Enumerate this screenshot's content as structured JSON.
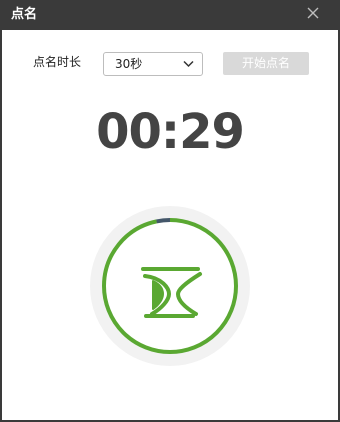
{
  "window": {
    "title": "点名"
  },
  "settings": {
    "duration_label": "点名时长",
    "duration_value": "30秒"
  },
  "actions": {
    "start_label": "开始点名"
  },
  "countdown": {
    "time_text": "00:29",
    "elapsed_fraction": 0.033,
    "track_color": "#f2f2f2",
    "remaining_color": "#5aa832",
    "elapsed_color": "#44576a",
    "icon": "hourglass-icon"
  }
}
